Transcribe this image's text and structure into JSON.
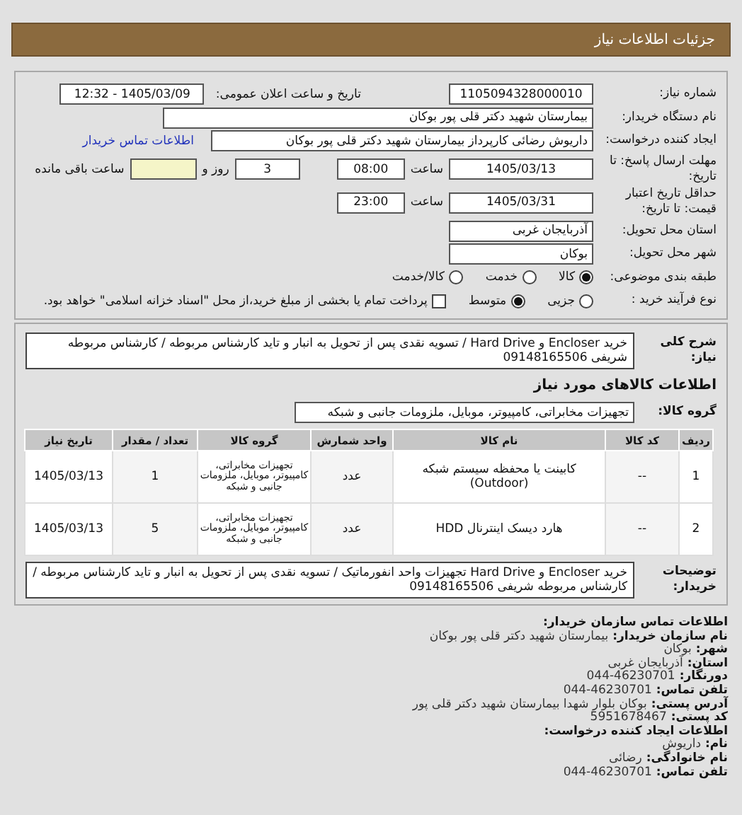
{
  "header": {
    "title": "جزئیات اطلاعات نیاز"
  },
  "request": {
    "need_number": {
      "label": "شماره نیاز:",
      "value": "1105094328000010"
    },
    "announce": {
      "label": "تاریخ و ساعت اعلان عمومی:",
      "value": "1405/03/09 - 12:32"
    },
    "buyer_org": {
      "label": "نام دستگاه خریدار:",
      "value": "بیمارستان شهید دکتر قلی پور بوکان"
    },
    "requester": {
      "label": "ایجاد کننده درخواست:",
      "value": "داریوش رضائی کارپرداز بیمارستان شهید دکتر قلی پور بوکان",
      "link": "اطلاعات تماس خریدار"
    },
    "deadline": {
      "label": "مهلت ارسال پاسخ: تا تاریخ:",
      "date": "1405/03/13",
      "time_label": "ساعت",
      "time": "08:00",
      "days": "3",
      "days_label": "روز و",
      "remaining_label": "ساعت باقی مانده"
    },
    "price_validity": {
      "label": "حداقل تاریخ اعتبار قیمت: تا تاریخ:",
      "date": "1405/03/31",
      "time_label": "ساعت",
      "time": "23:00"
    },
    "province": {
      "label": "استان محل تحویل:",
      "value": "آذربایجان غربی"
    },
    "city": {
      "label": "شهر محل تحویل:",
      "value": "بوکان"
    },
    "category": {
      "label": "طبقه بندی موضوعی:",
      "options": [
        {
          "label": "کالا",
          "selected": true
        },
        {
          "label": "خدمت",
          "selected": false
        },
        {
          "label": "کالا/خدمت",
          "selected": false
        }
      ]
    },
    "process": {
      "label": "نوع فرآیند خرید :",
      "options": [
        {
          "label": "جزیی",
          "selected": false
        },
        {
          "label": "متوسط",
          "selected": true
        }
      ],
      "treasury": {
        "label": "پرداخت تمام یا بخشی از مبلغ خرید،از محل \"اسناد خزانه اسلامی\" خواهد بود.",
        "checked": false
      }
    }
  },
  "needs": {
    "summary": {
      "label": "شرح کلی نیاز:",
      "value": "خرید Encloser و Hard Drive / تسویه نقدی پس از تحویل به انبار و تاید کارشناس مربوطه / کارشناس مربوطه شریفی 09148165506"
    },
    "section_title": "اطلاعات کالاهای مورد نیاز",
    "group": {
      "label": "گروه کالا:",
      "value": "تجهیزات مخابراتی، کامپیوتر، موبایل، ملزومات جانبی و شبکه"
    },
    "table": {
      "columns": [
        "ردیف",
        "کد کالا",
        "نام کالا",
        "واحد شمارش",
        "گروه کالا",
        "تعداد / مقدار",
        "تاریخ نیاز"
      ],
      "rows": [
        [
          "1",
          "--",
          "کابینت یا محفظه سیستم شبکه (Outdoor)",
          "عدد",
          "تجهیزات مخابراتی، کامپیوتر، موبایل، ملزومات جانبی و شبکه",
          "1",
          "1405/03/13"
        ],
        [
          "2",
          "--",
          "هارد دیسک اینترنال HDD",
          "عدد",
          "تجهیزات مخابراتی، کامپیوتر، موبایل، ملزومات جانبی و شبکه",
          "5",
          "1405/03/13"
        ]
      ]
    },
    "buyer_notes": {
      "label": "توضیحات خریدار:",
      "value": "خرید Encloser و Hard Drive تجهیزات واحد انفورماتیک / تسویه نقدی پس از تحویل به انبار و تاید کارشناس مربوطه / کارشناس مربوطه شریفی 09148165506"
    }
  },
  "contact": [
    {
      "kind": "heading",
      "label": "اطلاعات تماس سازمان خریدار:"
    },
    {
      "kind": "line",
      "label": "نام سازمان خریدار:",
      "value": "بیمارستان شهید دکتر قلی پور بوکان"
    },
    {
      "kind": "line",
      "label": "شهر:",
      "value": "بوکان"
    },
    {
      "kind": "line",
      "label": "استان:",
      "value": "آذربایجان غربی"
    },
    {
      "kind": "line",
      "label": "دورنگار:",
      "value": "044-46230701"
    },
    {
      "kind": "line",
      "label": "تلفن تماس:",
      "value": "044-46230701"
    },
    {
      "kind": "line",
      "label": "آدرس پستی:",
      "value": "بوکان بلوار شهدا بیمارستان شهید دکتر قلی پور"
    },
    {
      "kind": "line",
      "label": "کد پستی:",
      "value": "5951678467"
    },
    {
      "kind": "heading",
      "label": "اطلاعات ایجاد کننده درخواست:"
    },
    {
      "kind": "line",
      "label": "نام:",
      "value": "داریوش"
    },
    {
      "kind": "line",
      "label": "نام خانوادگی:",
      "value": "رضائی"
    },
    {
      "kind": "line",
      "label": "تلفن تماس:",
      "value": "044-46230701"
    }
  ]
}
